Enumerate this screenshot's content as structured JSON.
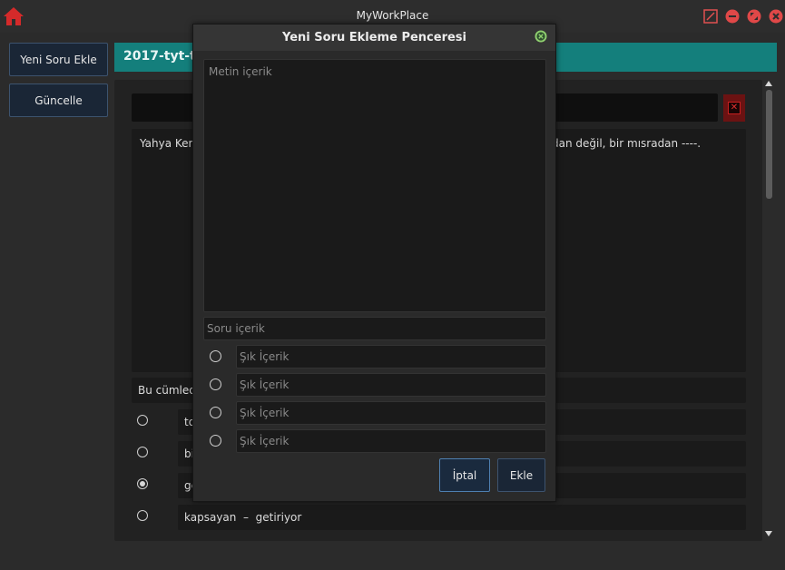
{
  "app": {
    "title": "MyWorkPlace"
  },
  "sidebar": {
    "add_question_label": "Yeni Soru Ekle",
    "update_label": "Güncelle"
  },
  "header": {
    "title": "2017-tyt-tu"
  },
  "main": {
    "text_left": "Yahya Kem",
    "text_right": "dan değil, bir mısradan ----.",
    "question_prefix": "Bu cümled",
    "options": [
      {
        "text": "to",
        "selected": false
      },
      {
        "text": "bi",
        "selected": false
      },
      {
        "text": "ge",
        "selected": true
      },
      {
        "text": "kapsayan  –  getiriyor",
        "selected": false
      }
    ]
  },
  "modal": {
    "title": "Yeni Soru Ekleme Penceresi",
    "text_placeholder": "Metin içerik",
    "question_placeholder": "Soru içerik",
    "choices": [
      "Şık İçerik",
      "Şık İçerik",
      "Şık İçerik",
      "Şık İçerik"
    ],
    "cancel_label": "İptal",
    "add_label": "Ekle"
  },
  "colors": {
    "accent": "#147f7c",
    "danger": "#6b1212",
    "button_bg": "#1a2636"
  }
}
